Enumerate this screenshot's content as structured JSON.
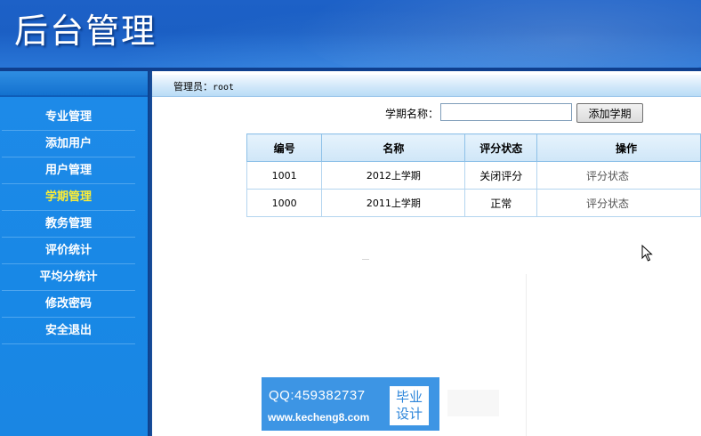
{
  "header": {
    "title": "后台管理"
  },
  "sidebar": {
    "items": [
      {
        "label": "专业管理",
        "active": false
      },
      {
        "label": "添加用户",
        "active": false
      },
      {
        "label": "用户管理",
        "active": false
      },
      {
        "label": "学期管理",
        "active": true
      },
      {
        "label": "教务管理",
        "active": false
      },
      {
        "label": "评价统计",
        "active": false
      },
      {
        "label": "平均分统计",
        "active": false
      },
      {
        "label": "修改密码",
        "active": false
      },
      {
        "label": "安全退出",
        "active": false
      }
    ]
  },
  "adminbar": {
    "label": "管理员：",
    "user": "root"
  },
  "form": {
    "label": "学期名称：",
    "input_value": "",
    "button_label": "添加学期"
  },
  "table": {
    "headers": [
      "编号",
      "名称",
      "评分状态",
      "操作"
    ],
    "rows": [
      {
        "id": "1001",
        "name": "2012上学期",
        "status": "关闭评分",
        "op": "评分状态"
      },
      {
        "id": "1000",
        "name": "2011上学期",
        "status": "正常",
        "op": "评分状态"
      }
    ]
  },
  "watermark": {
    "qq": "QQ:459382737",
    "site": "www.kecheng8.com",
    "badge_line1": "毕业",
    "badge_line2": "设计"
  },
  "colors": {
    "header": "#1d61c7",
    "sidebar": "#1e8ae8",
    "active_menu_text": "#ffee33",
    "table_border": "#8ec1e8"
  }
}
